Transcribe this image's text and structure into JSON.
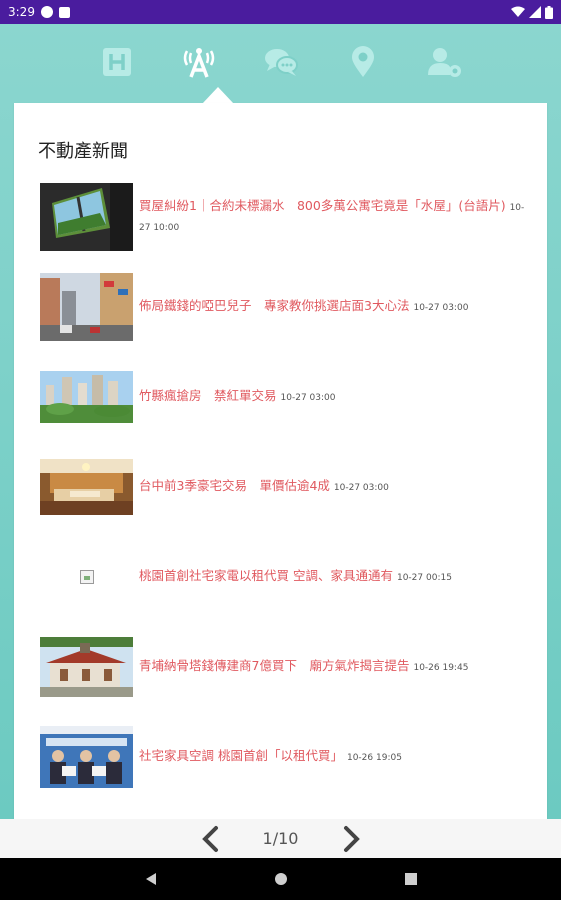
{
  "status_bar": {
    "time": "3:29",
    "icons": [
      "notification-p-icon",
      "sim-card-icon",
      "wifi-icon",
      "signal-icon",
      "battery-icon"
    ]
  },
  "tabs": [
    {
      "name": "H",
      "icon": "h-icon",
      "active": false
    },
    {
      "name": "A",
      "icon": "broadcast-a-icon",
      "active": true
    },
    {
      "name": "chat",
      "icon": "chat-bubbles-icon",
      "active": false
    },
    {
      "name": "location",
      "icon": "map-pin-icon",
      "active": false
    },
    {
      "name": "account-settings",
      "icon": "user-gear-icon",
      "active": false
    }
  ],
  "section_title": "不動產新聞",
  "news": [
    {
      "title": "買屋糾紛1｜合約未標漏水　800多萬公寓宅竟是「水屋」(台語片)",
      "time": "10-27 10:00",
      "thumb": "window-photo"
    },
    {
      "title": "佈局鐵錢的啞巴兒子　專家教你挑選店面3大心法",
      "time": "10-27 03:00",
      "thumb": "street-photo"
    },
    {
      "title": "竹縣瘋搶房　禁紅單交易",
      "time": "10-27 03:00",
      "thumb": "skyline-photo"
    },
    {
      "title": "台中前3季豪宅交易　單價估逾4成",
      "time": "10-27 03:00",
      "thumb": "living-room-photo"
    },
    {
      "title": "桃園首創社宅家電以租代買 空調、家具通通有",
      "time": "10-27 00:15",
      "thumb": "broken-image"
    },
    {
      "title": "青埔納骨塔錢傳建商7億買下　廟方氣炸揭言提告",
      "time": "10-26 19:45",
      "thumb": "temple-photo"
    },
    {
      "title": "社宅家具空調 桃園首創「以租代買」",
      "time": "10-26 19:05",
      "thumb": "ceremony-photo"
    }
  ],
  "pager": {
    "label": "1/10"
  },
  "colors": {
    "status_bar": "#4a1c9e",
    "background": "#7ed0c8",
    "link": "#e0595f",
    "active_tab": "#ffffff",
    "inactive_tab": "#b7ebe6"
  }
}
